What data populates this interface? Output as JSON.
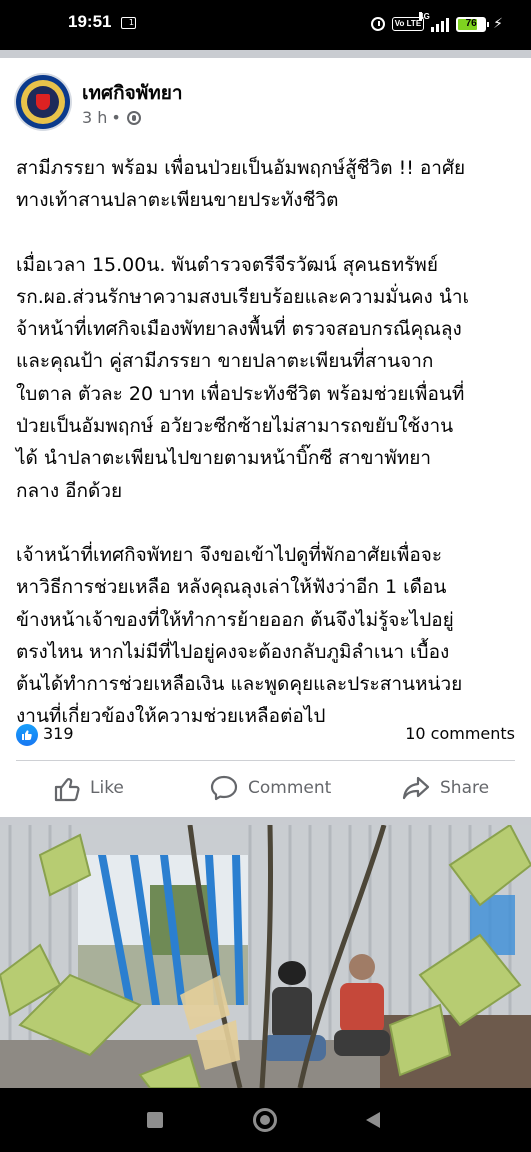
{
  "status_bar": {
    "time": "19:51",
    "sim_badge": "1",
    "network_label": "4G",
    "volte_label": "Vo LTE",
    "battery_percent": 76,
    "battery_label": "76",
    "icons": [
      "alarm-icon",
      "volte-icon",
      "signal-icon",
      "battery-icon",
      "charging-icon"
    ]
  },
  "post": {
    "page_name": "เทศกิจพัทยา",
    "time_ago": "3 h",
    "separator": "•",
    "privacy_icon": "globe-icon",
    "paragraphs": [
      "สามีภรรยา พร้อม เพื่อนป่วยเป็นอัมพฤกษ์สู้ชีวิต !! อาศัย\nทางเท้าสานปลาตะเพียนขายประทังชีวิต",
      "เมื่อเวลา 15.00น. พันตำรวจตรีจีรวัฒน์  สุคนธทรัพย์\nรก.ผอ.ส่วนรักษาความสงบเรียบร้อยและความมั่นคง  นำเ\nจ้าหน้าที่เทศกิจเมืองพัทยาลงพื้นที่ ตรวจสอบกรณีคุณลุง\nและคุณป้า คู่สามีภรรยา ขายปลาตะเพียนที่สานจาก\nใบตาล ตัวละ 20 บาท เพื่อประทังชีวิต  พร้อมช่วยเพื่อนที่\nป่วยเป็นอัมพฤกษ์ อวัยวะซีกซ้ายไม่สามารถขยับใช้งาน\nได้ นำปลาตะเพียนไปขายตามหน้าบิ๊กซี สาขาพัทยา\nกลาง อีกด้วย",
      "เจ้าหน้าที่เทศกิจพัทยา จึงขอเข้าไปดูที่พักอาศัยเพื่อจะ\nหาวิธีการช่วยเหลือ หลังคุณลุงเล่าให้ฟังว่าอีก 1 เดือน\nข้างหน้าเจ้าของที่ให้ทำการย้ายออก ต้นจึงไม่รู้จะไปอยู่\nตรงไหน หากไม่มีที่ไปอยู่คงจะต้องกลับภูมิลำเนา เบื้อง\nต้นได้ทำการช่วยเหลือเงิน และพูดคุยและประสานหน่วย\nงานที่เกี่ยวข้องให้ความช่วยเหลือต่อไป"
    ],
    "reaction_count": "319",
    "comments_label": "10 comments",
    "actions": {
      "like": "Like",
      "comment": "Comment",
      "share": "Share"
    },
    "colors": {
      "like_blue": "#1877f2",
      "secondary_text": "#65676b",
      "divider": "#ced0d4",
      "section_gap": "#c9ccd1"
    }
  },
  "navigation_bar": {
    "icons": [
      "recent-apps-icon",
      "home-icon",
      "back-icon"
    ]
  }
}
